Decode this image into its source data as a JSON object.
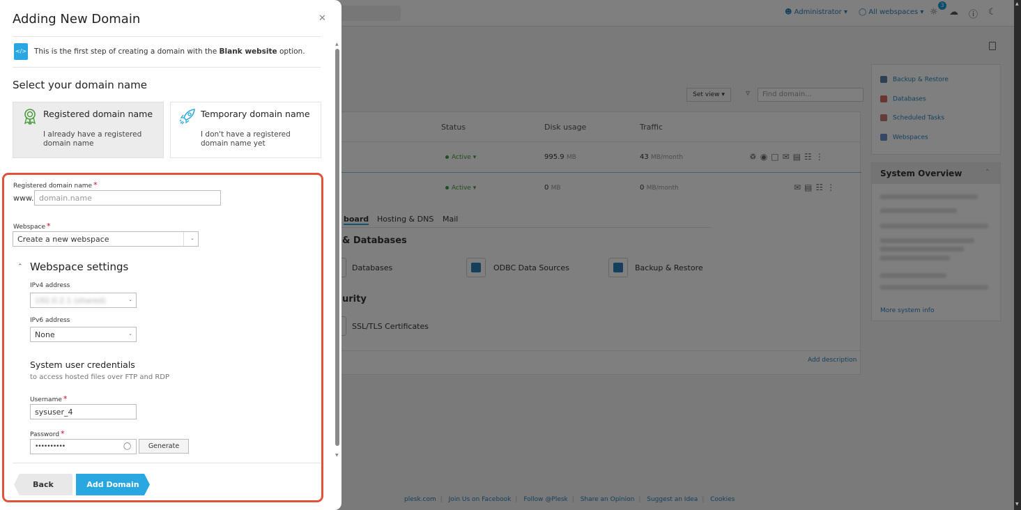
{
  "background": {
    "topbar": {
      "user": "Administrator",
      "webspaces": "All webspaces",
      "notification_count": "3"
    },
    "right_panel": {
      "links": [
        "Backup & Restore",
        "Databases",
        "Scheduled Tasks",
        "Webspaces"
      ]
    },
    "system_overview": {
      "title": "System Overview",
      "more_link": "More system info"
    },
    "toolbar": {
      "set_view": "Set view",
      "find_placeholder": "Find domain..."
    },
    "table": {
      "headers": [
        "Status",
        "Disk usage",
        "Traffic"
      ],
      "rows": [
        {
          "status": "Active",
          "disk": "995.9",
          "disk_unit": "MB",
          "traffic": "43",
          "traffic_unit": "MB/month"
        },
        {
          "status": "Active",
          "disk": "0",
          "disk_unit": "MB",
          "traffic": "0",
          "traffic_unit": "MB/month"
        }
      ]
    },
    "sub_tabs": [
      "board",
      "Hosting & DNS",
      "Mail"
    ],
    "sections": [
      {
        "title": "& Databases",
        "tools": [
          "Databases",
          "ODBC Data Sources",
          "Backup & Restore"
        ]
      },
      {
        "title": "urity",
        "tools": [
          "SSL/TLS Certificates"
        ]
      }
    ],
    "add_description": "Add description",
    "footer": [
      "plesk.com",
      "Join Us on Facebook",
      "Follow @Plesk",
      "Share an Opinion",
      "Suggest an Idea",
      "Cookies"
    ]
  },
  "dialog": {
    "title": "Adding New Domain",
    "info": {
      "prefix": "This is the first step of creating a domain with the ",
      "bold": "Blank website",
      "suffix": " option."
    },
    "select_title": "Select your domain name",
    "options": [
      {
        "title": "Registered domain name",
        "desc": "I already have a registered domain name",
        "selected": true,
        "icon": "award-icon"
      },
      {
        "title": "Temporary domain name",
        "desc": "I don't have a registered domain name yet",
        "selected": false,
        "icon": "rocket-icon"
      }
    ],
    "domain_field": {
      "label": "Registered domain name",
      "prefix": "www.",
      "placeholder": "domain.name",
      "value": ""
    },
    "webspace_field": {
      "label": "Webspace",
      "value": "Create a new webspace"
    },
    "webspace_settings": {
      "title": "Webspace settings",
      "ipv4_label": "IPv4 address",
      "ipv4_value": "192.0.2.1 (shared)",
      "ipv6_label": "IPv6 address",
      "ipv6_value": "None"
    },
    "credentials": {
      "title": "System user credentials",
      "subtitle": "to access hosted files over FTP and RDP",
      "username_label": "Username",
      "username_value": "sysuser_4",
      "password_label": "Password",
      "password_value": "••••••••••",
      "generate_label": "Generate"
    },
    "buttons": {
      "back": "Back",
      "add": "Add Domain"
    }
  },
  "colors": {
    "accent": "#28a7e0",
    "highlight": "#e1523d",
    "required": "#d0021b",
    "active": "#3c9a3c"
  }
}
